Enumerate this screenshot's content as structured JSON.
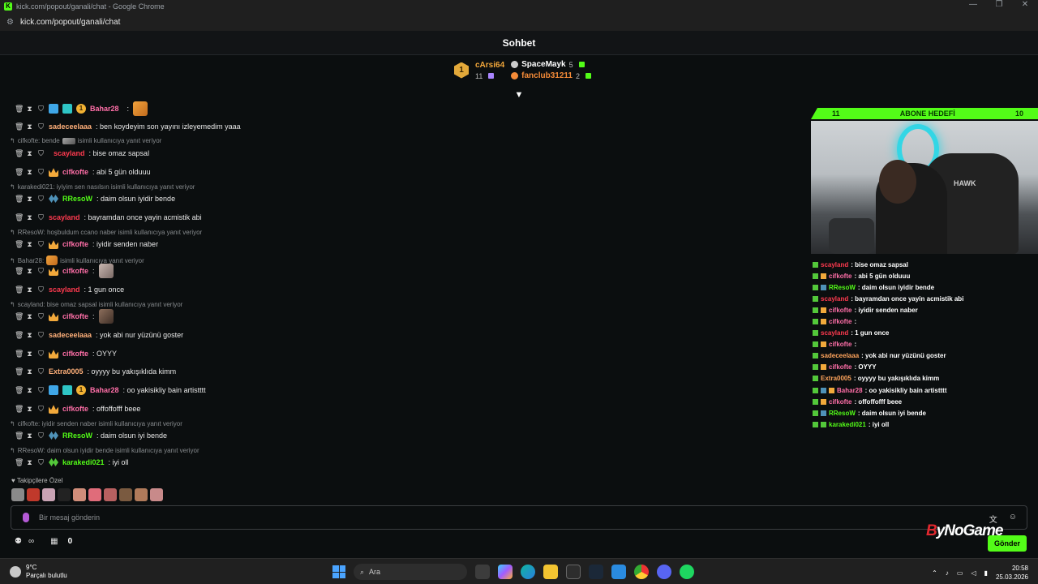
{
  "window": {
    "title": "kick.com/popout/ganali/chat - Google Chrome",
    "url": "kick.com/popout/ganali/chat",
    "controls": [
      "—",
      "❐",
      "✕"
    ]
  },
  "header": {
    "title": "Sohbet"
  },
  "gifters": {
    "top": {
      "rank": "1",
      "name": "cArsi64",
      "count": "11"
    },
    "others": [
      {
        "name": "SpaceMayk",
        "count": "5"
      },
      {
        "name": "fanclub31211",
        "count": "2"
      }
    ]
  },
  "messages": [
    {
      "user": "Bahar28",
      "text": ""
    },
    {
      "user": "sadeceelaaa",
      "text": ": ben koydeyim son yayını izleyemedim yaaa"
    },
    {
      "reply": "cifkofte: bende",
      "reply_suffix": "isimli kullanıcıya yanıt veriyor"
    },
    {
      "user": "scayland",
      "text": ": bise omaz sapsal"
    },
    {
      "user": "cifkofte",
      "text": ": abi 5 gün olduuu"
    },
    {
      "reply": "karakedi021: iyiyim sen nasılsın isimli kullanıcıya yanıt veriyor"
    },
    {
      "user": "RResoW",
      "text": ": daim olsun iyidir bende"
    },
    {
      "user": "scayland",
      "text": ": bayramdan once yayin acmistik abi"
    },
    {
      "reply": "RResoW: hoşbuldum ccano naber isimli kullanıcıya yanıt veriyor"
    },
    {
      "user": "cifkofte",
      "text": ": iyidir senden naber"
    },
    {
      "reply": "Bahar28:",
      "reply_suffix": "isimli kullanıcıya yanıt veriyor"
    },
    {
      "user": "cifkofte",
      "text": ":"
    },
    {
      "user": "scayland",
      "text": ": 1 gun once"
    },
    {
      "reply": "scayland: bise omaz sapsal isimli kullanıcıya yanıt veriyor"
    },
    {
      "user": "cifkofte",
      "text": ":"
    },
    {
      "user": "sadeceelaaa",
      "text": ": yok abi nur yüzünü goster"
    },
    {
      "user": "cifkofte",
      "text": ": OYYY"
    },
    {
      "user": "Extra0005",
      "text": ": oyyyy bu yakışıklıda kimm"
    },
    {
      "user": "Bahar28",
      "text": ": oo yakisikliy bain artistttt"
    },
    {
      "user": "cifkofte",
      "text": ": offoffofff beee"
    },
    {
      "reply": "cifkofte: iyidir senden naber isimli kullanıcıya yanıt veriyor"
    },
    {
      "user": "RResoW",
      "text": ": daim olsun iyi bende"
    },
    {
      "reply": "RResoW: daim olsun iyidir bende isimli kullanıcıya yanıt veriyor"
    },
    {
      "user": "karakedi021",
      "text": ": iyi oll"
    }
  ],
  "followers_label": "Takipçilere Özel",
  "input": {
    "placeholder": "Bir mesaj gönderin"
  },
  "bottom": {
    "infinity": "∞",
    "count": "0",
    "send": "Gönder"
  },
  "overlay": {
    "goal_left": "11",
    "goal_title": "ABONE HEDEFİ",
    "goal_right": "10",
    "cam_logo": "HAWK",
    "lines": [
      {
        "user": "scayland",
        "text": ": bise omaz sapsal"
      },
      {
        "user": "cifkofte",
        "text": ": abi 5 gün olduuu"
      },
      {
        "user": "RResoW",
        "text": ": daim olsun iyidir bende"
      },
      {
        "user": "scayland",
        "text": ": bayramdan once yayin acmistik abi"
      },
      {
        "user": "cifkofte",
        "text": ": iyidir senden naber"
      },
      {
        "user": "cifkofte",
        "text": ":"
      },
      {
        "user": "scayland",
        "text": ": 1 gun once"
      },
      {
        "user": "cifkofte",
        "text": ":"
      },
      {
        "user": "sadeceelaaa",
        "text": ": yok abi nur yüzünü goster"
      },
      {
        "user": "cifkofte",
        "text": ": OYYY"
      },
      {
        "user": "Extra0005",
        "text": ": oyyyy bu yakışıklıda kimm"
      },
      {
        "user": "Bahar28",
        "text": ": oo yakisikliy bain artistttt"
      },
      {
        "user": "cifkofte",
        "text": ": offoffofff beee"
      },
      {
        "user": "RResoW",
        "text": ": daim olsun iyi bende"
      },
      {
        "user": "karakedi021",
        "text": ": iyi oll"
      }
    ]
  },
  "watermark": {
    "mark": "B",
    "text": "yNoGame"
  },
  "taskbar": {
    "weather_temp": "9°C",
    "weather_desc": "Parçalı bulutlu",
    "search": "Ara",
    "time": "20:58",
    "date": "25.03.2026"
  },
  "colors": {
    "accent": "#53fc18",
    "background": "#0b0e0f"
  }
}
